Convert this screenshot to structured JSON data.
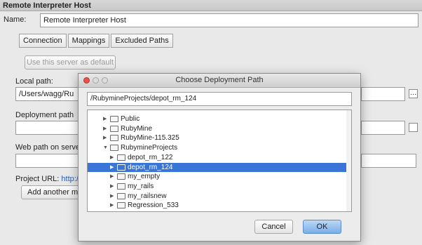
{
  "back_window": {
    "title": "Remote Interpreter Host",
    "name_label": "Name:",
    "name_value": "Remote Interpreter Host",
    "tabs": [
      {
        "label": "Connection"
      },
      {
        "label": "Mappings"
      },
      {
        "label": "Excluded Paths"
      }
    ],
    "use_default_button": "Use this server as default",
    "local_path_label": "Local path:",
    "local_path_value": "/Users/wagg/Ru",
    "deployment_path_label": "Deployment path",
    "deployment_path_value": "",
    "web_path_label": "Web path on serve",
    "web_path_value": "",
    "project_url_label": "Project URL:",
    "project_url_link": "http:/",
    "add_mapping_button": "Add another m",
    "browse_glyph": "…"
  },
  "dialog": {
    "title": "Choose Deployment Path",
    "path_value": "/RubymineProjects/depot_rm_124",
    "tree": [
      {
        "label": "Public",
        "expanded": false,
        "selected": false,
        "level": 0
      },
      {
        "label": "RubyMine",
        "expanded": false,
        "selected": false,
        "level": 0
      },
      {
        "label": "RubyMine-115.325",
        "expanded": false,
        "selected": false,
        "level": 0
      },
      {
        "label": "RubymineProjects",
        "expanded": true,
        "selected": false,
        "level": 0
      },
      {
        "label": "depot_rm_122",
        "expanded": false,
        "selected": false,
        "level": 1
      },
      {
        "label": "depot_rm_124",
        "expanded": false,
        "selected": true,
        "level": 1
      },
      {
        "label": "my_empty",
        "expanded": false,
        "selected": false,
        "level": 1
      },
      {
        "label": "my_rails",
        "expanded": false,
        "selected": false,
        "level": 1
      },
      {
        "label": "my_railsnew",
        "expanded": false,
        "selected": false,
        "level": 1
      },
      {
        "label": "Regression_533",
        "expanded": false,
        "selected": false,
        "level": 1
      }
    ],
    "cancel_label": "Cancel",
    "ok_label": "OK"
  },
  "colors": {
    "selection": "#3875d7",
    "close_light": "#e5534b",
    "link": "#2a5db0"
  }
}
